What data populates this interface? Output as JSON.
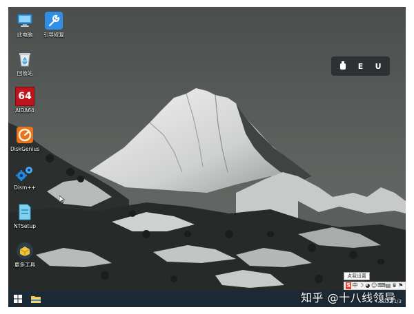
{
  "desktop": {
    "icons": [
      {
        "label": "此电脑",
        "icon": "computer-icon"
      },
      {
        "label": "引导修复",
        "icon": "wrench-icon"
      },
      {
        "label": "回收站",
        "icon": "recycle-bin-icon"
      },
      {
        "label": "AIDA64",
        "icon": "aida64-icon",
        "glyph_text": "64"
      },
      {
        "label": "DiskGenius",
        "icon": "diskgenius-icon"
      },
      {
        "label": "Dism++",
        "icon": "gears-icon"
      },
      {
        "label": "NTSetup",
        "icon": "ntsetup-icon"
      },
      {
        "label": "更多工具",
        "icon": "toolbox-icon"
      }
    ]
  },
  "drive_bar": {
    "items": [
      {
        "label": "",
        "icon": "usb-drive-icon"
      },
      {
        "label": "E"
      },
      {
        "label": "U"
      }
    ]
  },
  "taskbar": {
    "start_icon": "windows-start-icon",
    "explorer_icon": "file-explorer-icon",
    "date": "2023/1/3"
  },
  "ime": {
    "tooltip": "点我设置",
    "items": [
      "S",
      "中",
      "☽",
      "◕",
      "☺",
      "⌨",
      "▤",
      "♛",
      "⚑",
      "✦"
    ]
  },
  "watermark": "知乎 @十八线领导",
  "colors": {
    "desktop_sky": "#5d625f",
    "taskbar": "#1c2a36",
    "drive_bar": "#2e3133",
    "aida_red": "#c0141c",
    "diskgenius_orange": "#e8731c",
    "dism_blue": "#1e88e5"
  }
}
